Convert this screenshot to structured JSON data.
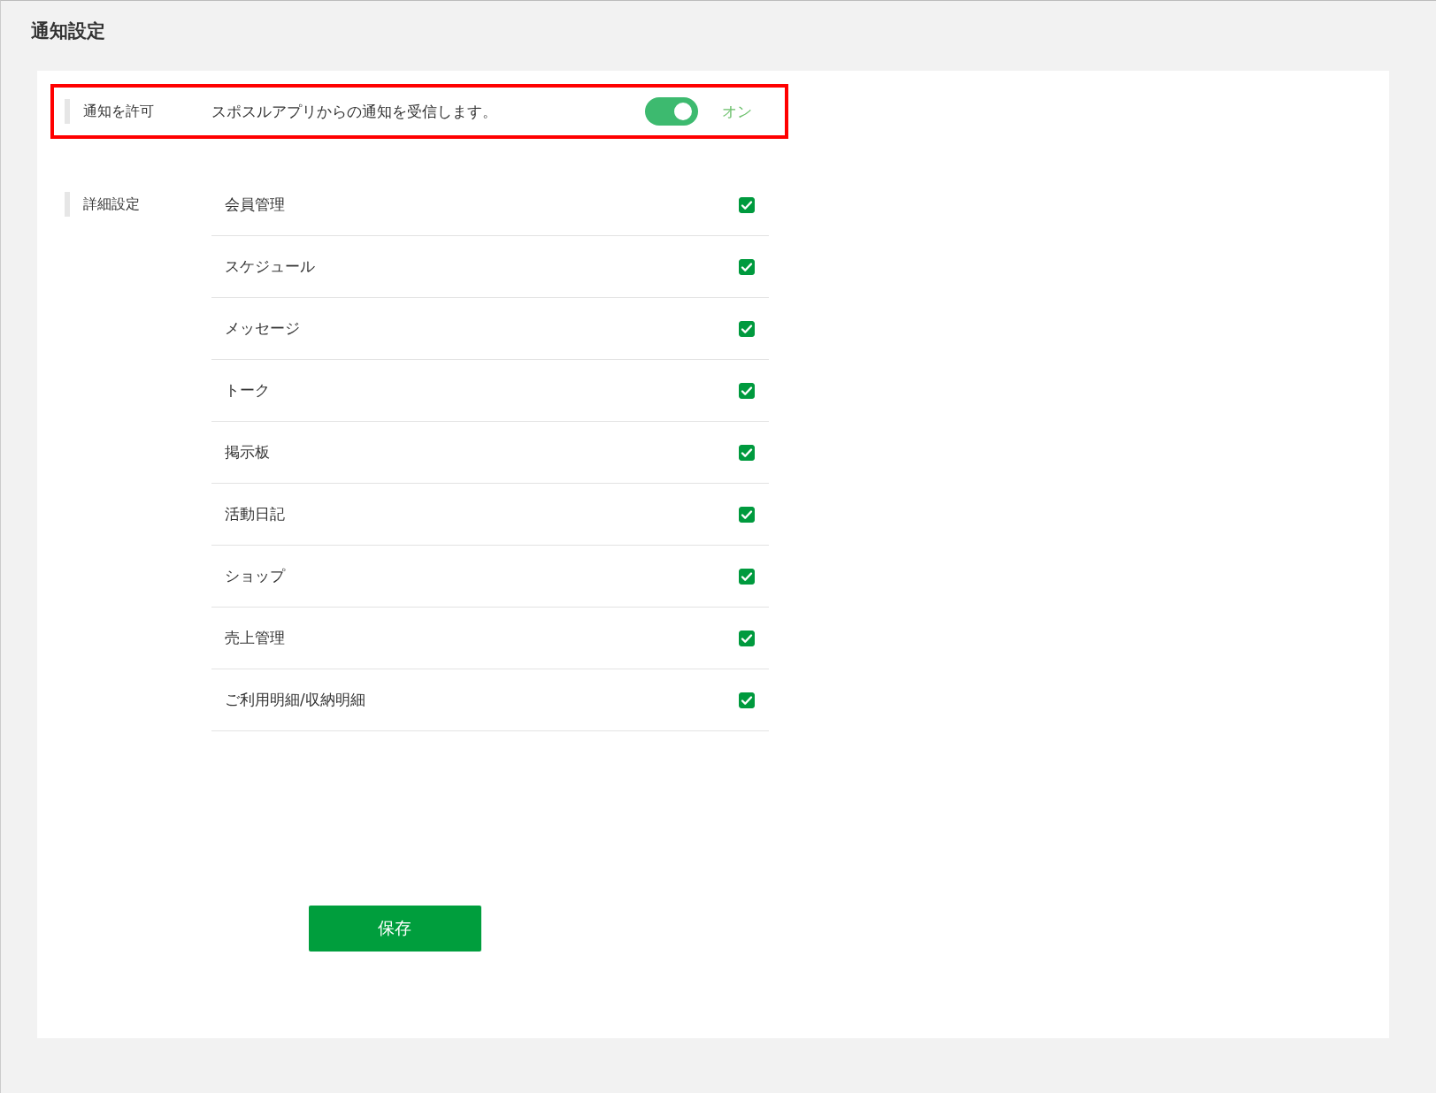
{
  "page_title": "通知設定",
  "allow": {
    "label": "通知を許可",
    "description": "スポスルアプリからの通知を受信します。",
    "on": true,
    "status": "オン",
    "highlighted": true
  },
  "details": {
    "label": "詳細設定",
    "items": [
      {
        "label": "会員管理",
        "checked": true
      },
      {
        "label": "スケジュール",
        "checked": true
      },
      {
        "label": "メッセージ",
        "checked": true
      },
      {
        "label": "トーク",
        "checked": true
      },
      {
        "label": "掲示板",
        "checked": true
      },
      {
        "label": "活動日記",
        "checked": true
      },
      {
        "label": "ショップ",
        "checked": true
      },
      {
        "label": "売上管理",
        "checked": true
      },
      {
        "label": "ご利用明細/収納明細",
        "checked": true
      }
    ]
  },
  "save_button": "保存"
}
